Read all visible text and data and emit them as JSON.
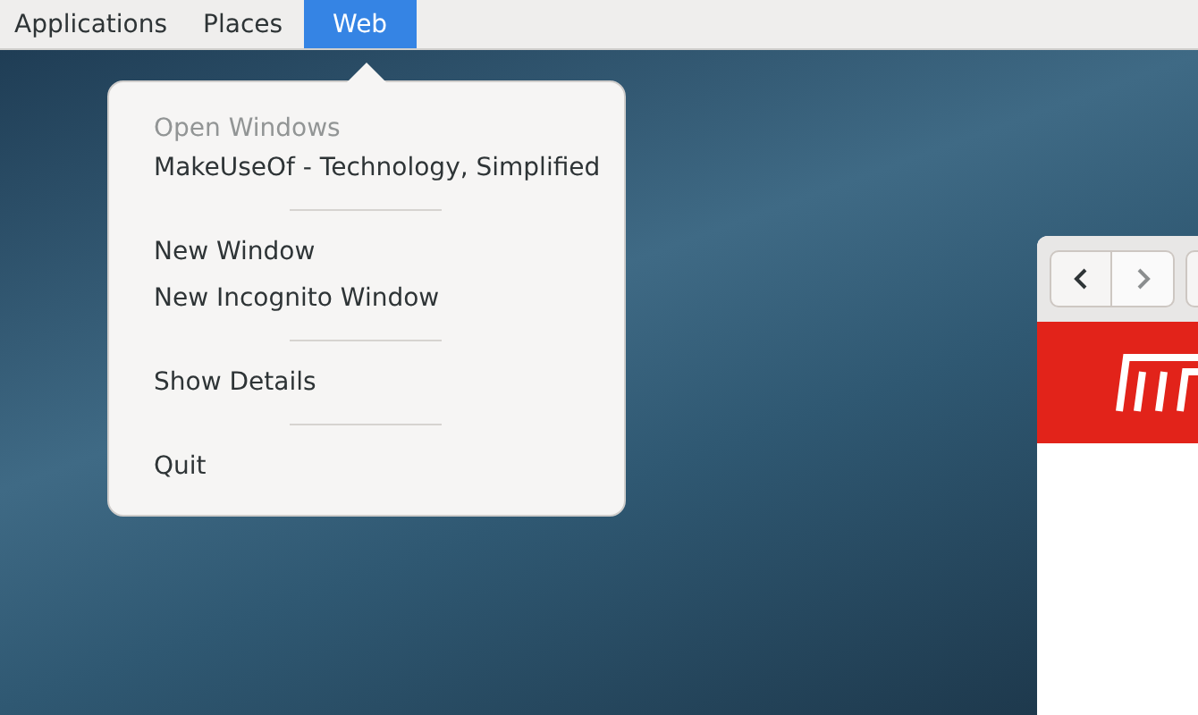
{
  "top_bar": {
    "menus": [
      {
        "label": "Applications",
        "selected": false
      },
      {
        "label": "Places",
        "selected": false
      },
      {
        "label": "Web",
        "selected": true
      }
    ]
  },
  "app_menu": {
    "items": [
      {
        "kind": "heading",
        "label": "Open Windows"
      },
      {
        "kind": "item",
        "label": "MakeUseOf - Technology, Simplified"
      },
      {
        "kind": "separator"
      },
      {
        "kind": "item",
        "label": "New Window"
      },
      {
        "kind": "item",
        "label": "New Incognito Window"
      },
      {
        "kind": "separator"
      },
      {
        "kind": "item",
        "label": "Show Details"
      },
      {
        "kind": "separator"
      },
      {
        "kind": "item",
        "label": "Quit"
      }
    ]
  }
}
